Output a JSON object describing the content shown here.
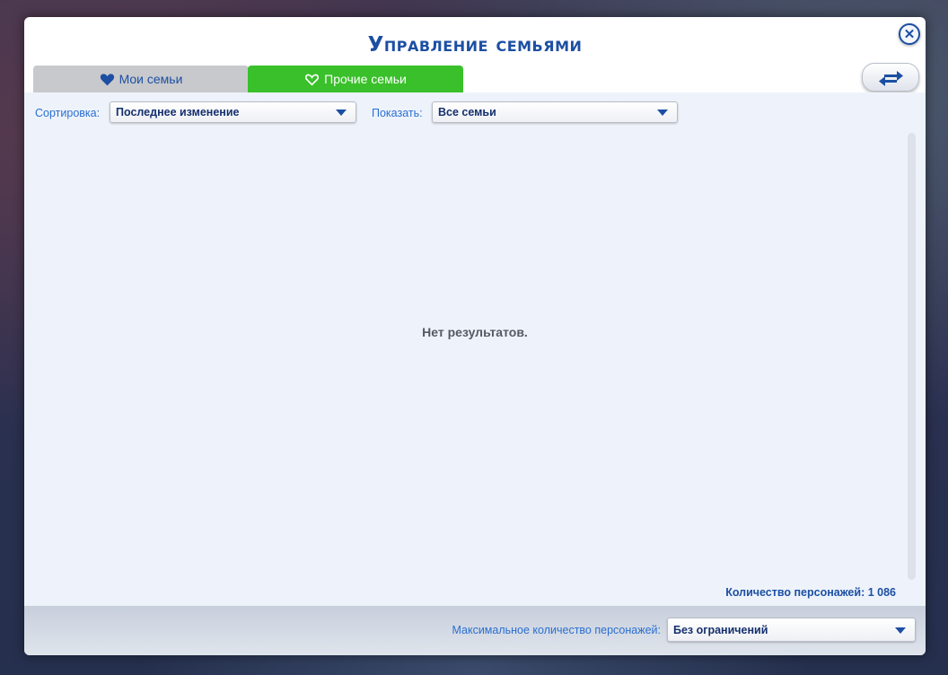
{
  "dialog": {
    "title": "Управление семьями",
    "close_symbol": "✕"
  },
  "tabs": [
    {
      "label": "Мои семьи",
      "icon": "filled-heart-icon",
      "selected": false
    },
    {
      "label": "Прочие семьи",
      "icon": "outline-heart-icon",
      "selected": true
    }
  ],
  "toolbar": {
    "swap_icon": "transfer-arrows-icon"
  },
  "filters": {
    "sort_label": "Сортировка:",
    "sort_value": "Последнее изменение",
    "show_label": "Показать:",
    "show_value": "Все семьи"
  },
  "results": {
    "empty_message": "Нет результатов."
  },
  "stats": {
    "sim_count": "Количество персонажей: 1 086"
  },
  "footer": {
    "max_sims_label": "Максимальное количество персонажей:",
    "max_sims_value": "Без ограничений"
  },
  "colors": {
    "accent_blue": "#1c4fa3",
    "active_tab_green": "#39c02a",
    "inactive_tab_gray": "#c8c9cc",
    "content_bg": "#eef3fb"
  }
}
